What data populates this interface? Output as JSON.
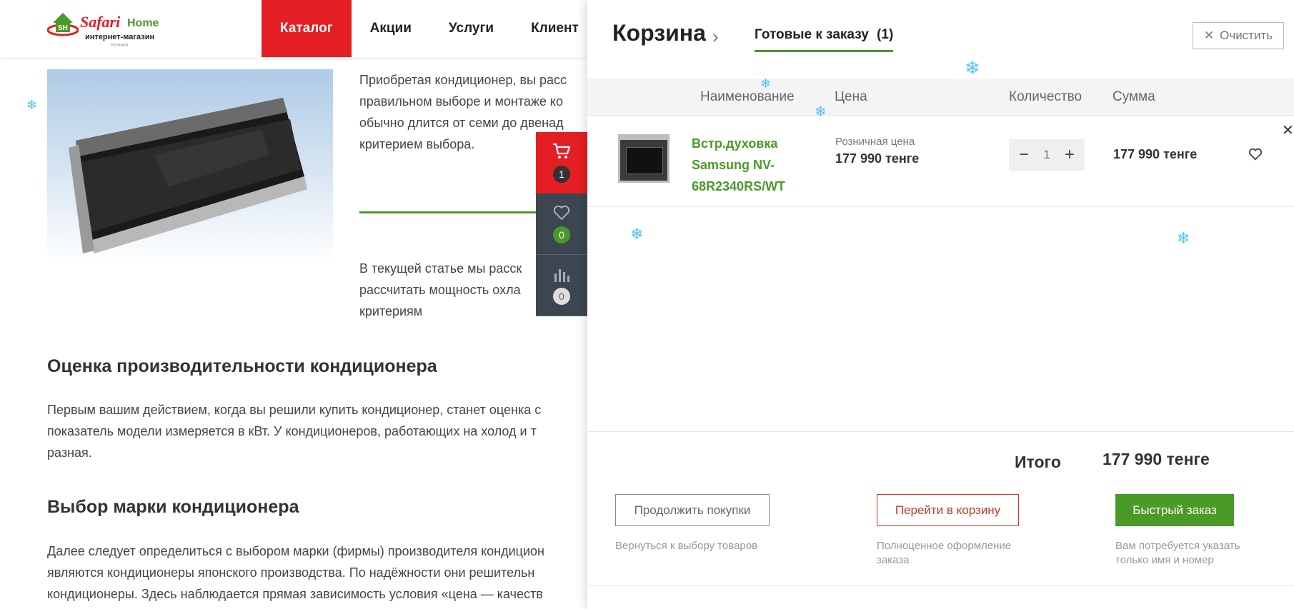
{
  "header": {
    "logo": {
      "word1": "Safari",
      "word2": "Home",
      "subtitle": "интернет-магазин",
      "tag": "техники"
    },
    "nav": [
      "Каталог",
      "Акции",
      "Услуги",
      "Клиент"
    ]
  },
  "article": {
    "intro_lines": [
      "Приобретая кондиционер, вы расс",
      "правильном выборе и монтаже ко",
      "обычно длится от семи до двенад",
      "критерием выбора."
    ],
    "second_lines": [
      "В текущей статье мы расск",
      "рассчитать мощность охла",
      "критериям"
    ],
    "h1": "Оценка производительности кондиционера",
    "p1_lines": [
      "Первым вашим действием, когда вы решили купить кондиционер, станет оценка с",
      "показатель модели измеряется в кВт. У кондиционеров, работающих на холод и т",
      "разная."
    ],
    "h2": "Выбор марки кондиционера",
    "p2_lines": [
      "Далее следует определиться с выбором марки (фирмы) производителя кондицион",
      "являются кондиционеры японского производства. По надёжности они решительн",
      "кондиционеры. Здесь наблюдается прямая зависимость условия «цена — качеств"
    ]
  },
  "side_widget": {
    "cart_count": "1",
    "favorites_count": "0",
    "compare_count": "0"
  },
  "cart": {
    "title": "Корзина",
    "tab_label": "Готовые к заказу",
    "tab_count": "(1)",
    "clear_label": "Очистить",
    "columns": {
      "name": "Наименование",
      "price": "Цена",
      "qty": "Количество",
      "sum": "Сумма"
    },
    "items": [
      {
        "name": "Встр.духовка Samsung NV-68R2340RS/WT",
        "price_label": "Розничная цена",
        "price": "177 990 тенге",
        "qty": "1",
        "sum": "177 990 тенге"
      }
    ],
    "total_label": "Итого",
    "total_value": "177 990 тенге",
    "actions": {
      "continue_label": "Продолжить покупки",
      "continue_note": "Вернуться к выбору товаров",
      "go_cart_label": "Перейти в корзину",
      "go_cart_note": "Полноценное оформление заказа",
      "quick_label": "Быстрый заказ",
      "quick_note": "Вам потребуется указать только имя и номер"
    }
  },
  "colors": {
    "brand_red": "#e31e24",
    "brand_green": "#4a9a28",
    "snow": "#4fc3f7"
  }
}
